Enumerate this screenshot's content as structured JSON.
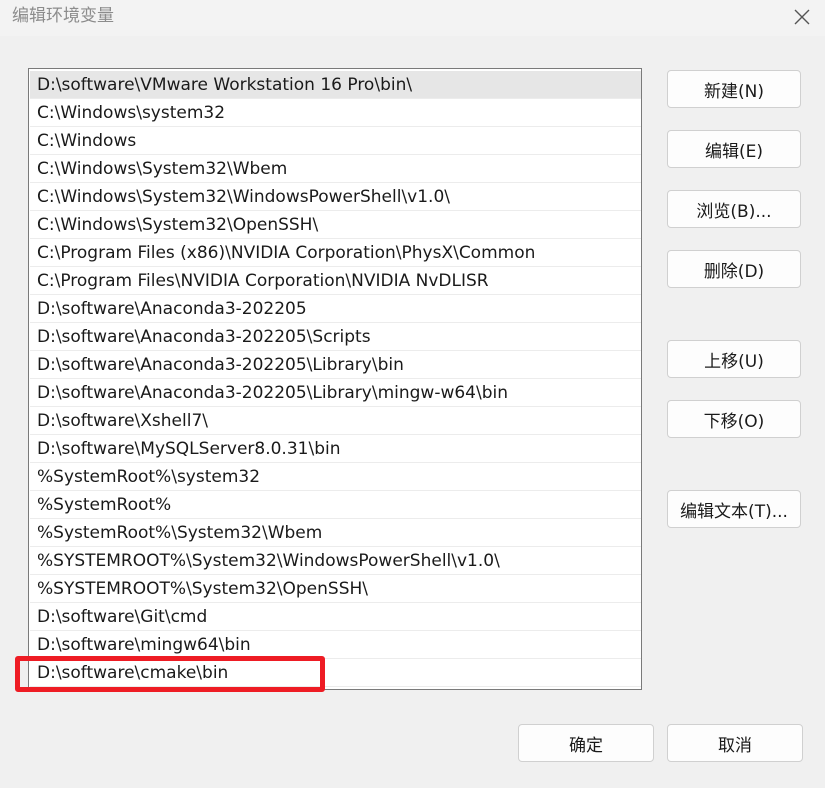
{
  "window": {
    "title": "编辑环境变量",
    "close_icon": "close-icon"
  },
  "list": {
    "items": [
      "D:\\software\\VMware Workstation 16 Pro\\bin\\",
      "C:\\Windows\\system32",
      "C:\\Windows",
      "C:\\Windows\\System32\\Wbem",
      "C:\\Windows\\System32\\WindowsPowerShell\\v1.0\\",
      "C:\\Windows\\System32\\OpenSSH\\",
      "C:\\Program Files (x86)\\NVIDIA Corporation\\PhysX\\Common",
      "C:\\Program Files\\NVIDIA Corporation\\NVIDIA NvDLISR",
      "D:\\software\\Anaconda3-202205",
      "D:\\software\\Anaconda3-202205\\Scripts",
      "D:\\software\\Anaconda3-202205\\Library\\bin",
      "D:\\software\\Anaconda3-202205\\Library\\mingw-w64\\bin",
      "D:\\software\\Xshell7\\",
      "D:\\software\\MySQLServer8.0.31\\bin",
      "%SystemRoot%\\system32",
      "%SystemRoot%",
      "%SystemRoot%\\System32\\Wbem",
      "%SYSTEMROOT%\\System32\\WindowsPowerShell\\v1.0\\",
      "%SYSTEMROOT%\\System32\\OpenSSH\\",
      "D:\\software\\Git\\cmd",
      "D:\\software\\mingw64\\bin",
      "D:\\software\\cmake\\bin"
    ],
    "selected_index": 0,
    "highlighted_index": 21,
    "highlight_color": "#ee1c24"
  },
  "buttons": {
    "new": "新建(N)",
    "edit": "编辑(E)",
    "browse": "浏览(B)...",
    "delete": "删除(D)",
    "move_up": "上移(U)",
    "move_down": "下移(O)",
    "edit_text": "编辑文本(T)...",
    "ok": "确定",
    "cancel": "取消"
  }
}
